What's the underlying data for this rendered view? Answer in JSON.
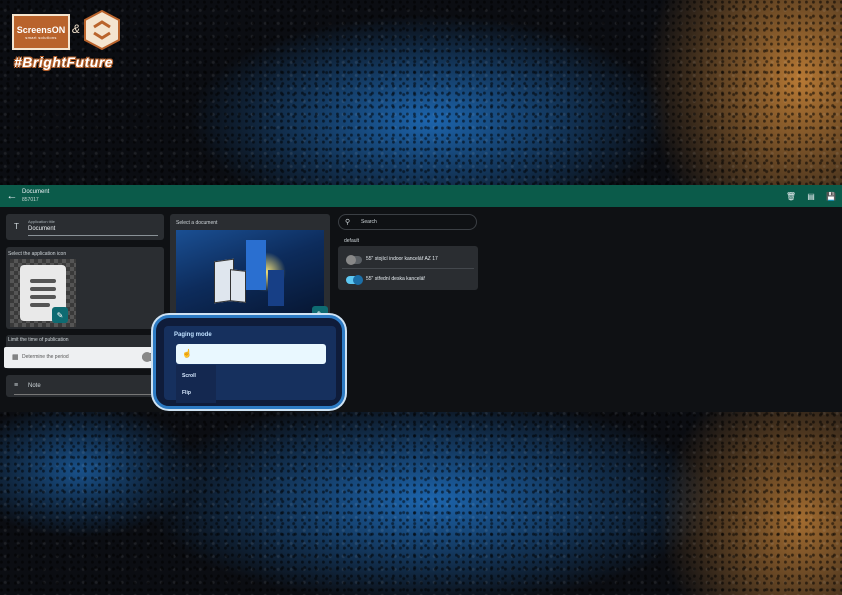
{
  "logo": {
    "brand": "ScreensON",
    "brand_sub": "smart solutions",
    "ampersand": "&",
    "tagline": "#BrightFuture"
  },
  "header": {
    "title": "Document",
    "subtitle": "857017",
    "icons": [
      "back-arrow-icon",
      "delete-icon",
      "export-icon",
      "save-icon"
    ]
  },
  "form": {
    "app_title_caption": "Application title",
    "app_title_value": "Document",
    "app_icon_label": "Select the application icon",
    "limit_label": "Limit the time of publication",
    "limit_field": "Determine the period",
    "note_label": "Note",
    "document_label": "Select a document"
  },
  "search": {
    "placeholder": "Search",
    "group": "default",
    "items": [
      {
        "label": "55\" stojící indoor kancelář AZ 17",
        "enabled": false
      },
      {
        "label": "55\" střední deska kancelář",
        "enabled": true
      }
    ]
  },
  "paging": {
    "title": "Paging mode",
    "options": [
      "Scroll",
      "Flip"
    ]
  },
  "colors": {
    "appbar": "#0b5b4a",
    "accent": "#2d7bc4",
    "toggle_on": "#5ec8f2"
  }
}
